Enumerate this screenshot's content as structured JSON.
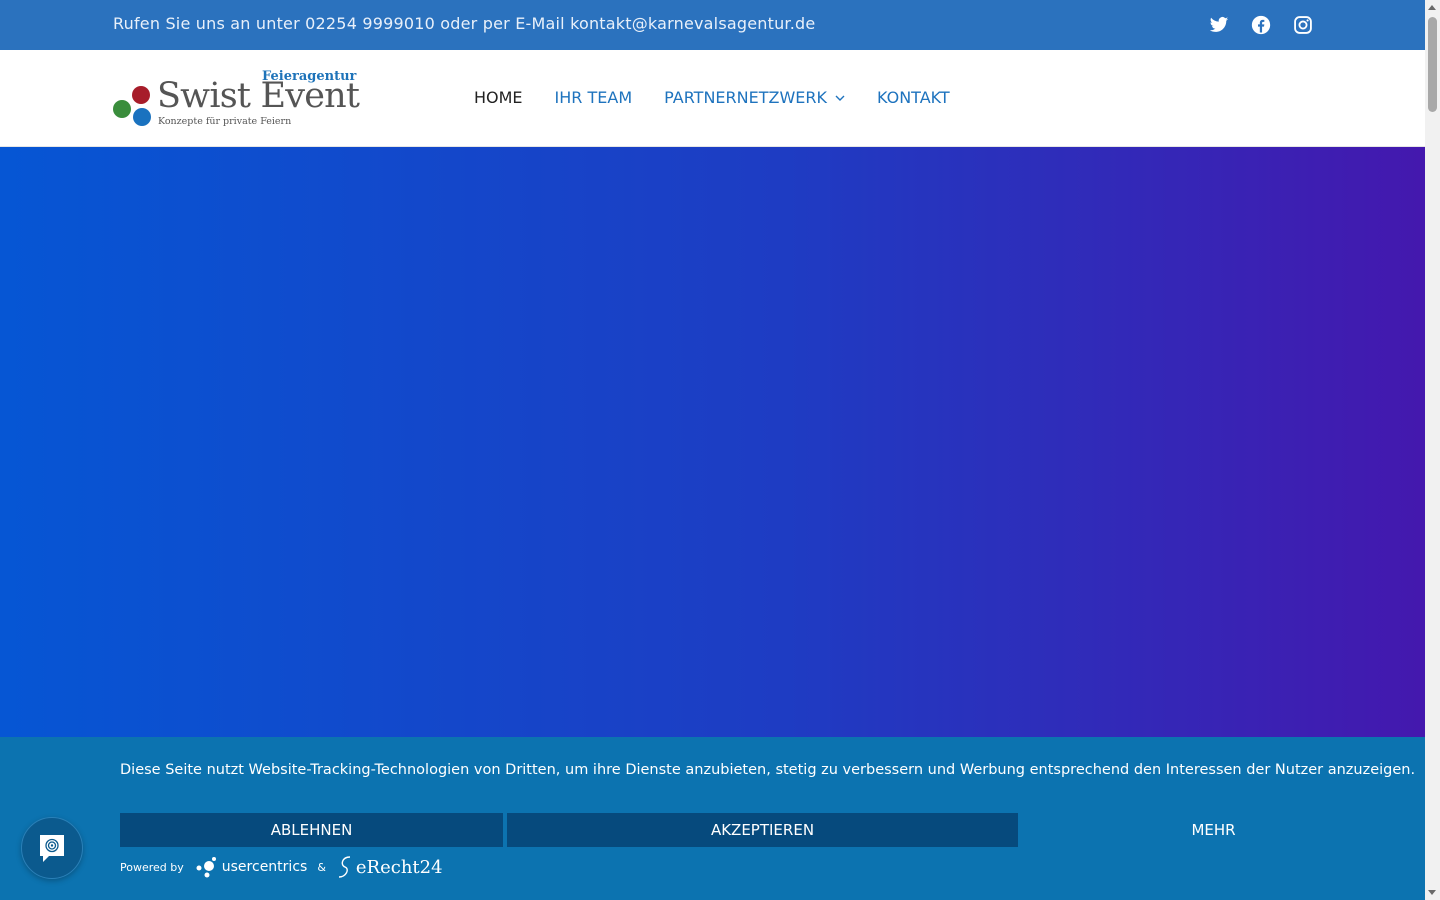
{
  "topbar": {
    "contact_text": "Rufen Sie uns an unter 02254 9999010 oder per E-Mail kontakt@karnevalsagentur.de",
    "social_icons": [
      "twitter-icon",
      "facebook-icon",
      "instagram-icon"
    ]
  },
  "logo": {
    "top": "Feieragentur",
    "main": "Swist Event",
    "sub": "Konzepte für private Feiern"
  },
  "nav": {
    "items": [
      {
        "label": "HOME",
        "active": true
      },
      {
        "label": "IHR TEAM",
        "active": false
      },
      {
        "label": "PARTNERNETZWERK",
        "active": false,
        "has_dropdown": true
      },
      {
        "label": "KONTAKT",
        "active": false
      }
    ]
  },
  "cookie": {
    "message": "Diese Seite nutzt Website-Tracking-Technologien von Dritten, um ihre Dienste anzubieten, stetig zu verbessern und Werbung entsprechend den Interessen der Nutzer anzuzeigen.",
    "reject_label": "ABLEHNEN",
    "accept_label": "AKZEPTIEREN",
    "more_label": "MEHR",
    "powered_by": "Powered by",
    "usercentrics": "usercentrics",
    "ampersand": "&",
    "erecht": "eRecht24"
  },
  "colors": {
    "topbar": "#2b72be",
    "nav_link": "#1e73be",
    "cookie_bg": "#0c73b0",
    "cookie_button": "#064a7d",
    "hero_start": "#0656d4",
    "hero_end": "#4418ae"
  }
}
